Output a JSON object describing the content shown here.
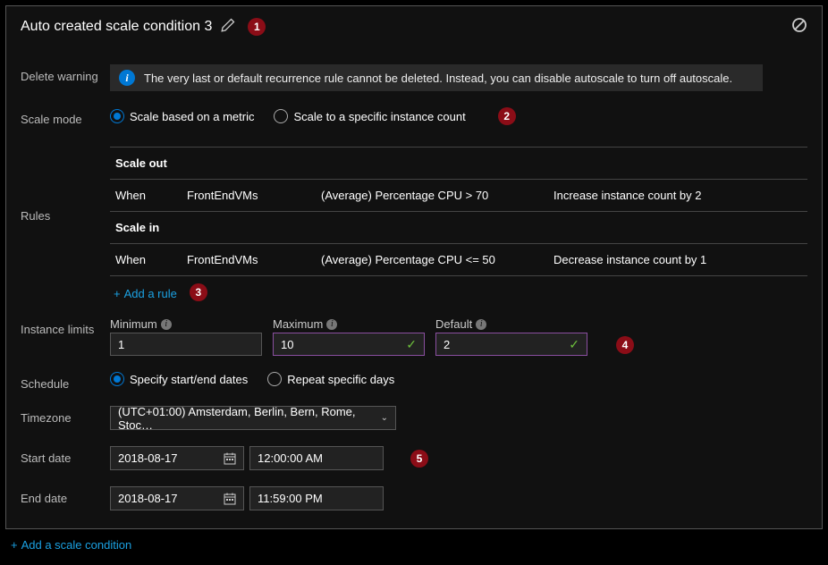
{
  "header": {
    "title": "Auto created scale condition 3"
  },
  "warning": {
    "label": "Delete warning",
    "text": "The very last or default recurrence rule cannot be deleted. Instead, you can disable autoscale to turn off autoscale."
  },
  "scale_mode": {
    "label": "Scale mode",
    "option_metric": "Scale based on a metric",
    "option_count": "Scale to a specific instance count"
  },
  "rules": {
    "label": "Rules",
    "scale_out_title": "Scale out",
    "scale_in_title": "Scale in",
    "out": {
      "when": "When",
      "resource": "FrontEndVMs",
      "condition": "(Average) Percentage CPU > 70",
      "action": "Increase instance count by 2"
    },
    "in_": {
      "when": "When",
      "resource": "FrontEndVMs",
      "condition": "(Average) Percentage CPU <= 50",
      "action": "Decrease instance count by 1"
    },
    "add_rule": "Add a rule"
  },
  "limits": {
    "label": "Instance limits",
    "min_label": "Minimum",
    "max_label": "Maximum",
    "def_label": "Default",
    "min": "1",
    "max": "10",
    "def": "2"
  },
  "schedule": {
    "label": "Schedule",
    "option_dates": "Specify start/end dates",
    "option_days": "Repeat specific days"
  },
  "timezone": {
    "label": "Timezone",
    "value": "(UTC+01:00) Amsterdam, Berlin, Bern, Rome, Stoc…"
  },
  "start": {
    "label": "Start date",
    "date": "2018-08-17",
    "time": "12:00:00 AM"
  },
  "end": {
    "label": "End date",
    "date": "2018-08-17",
    "time": "11:59:00 PM"
  },
  "footer": {
    "add_condition": "Add a scale condition"
  },
  "callouts": {
    "c1": "1",
    "c2": "2",
    "c3": "3",
    "c4": "4",
    "c5": "5"
  }
}
